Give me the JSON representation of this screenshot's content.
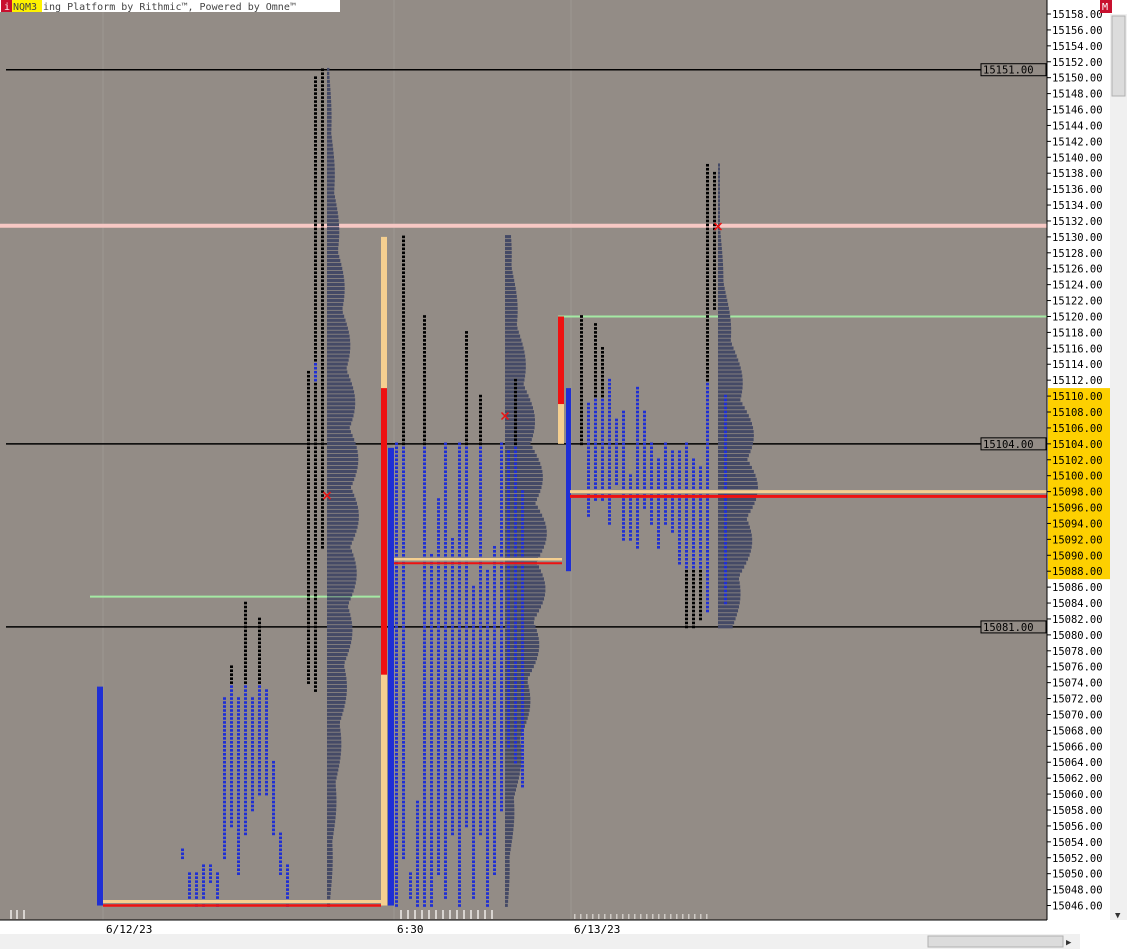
{
  "window": {
    "title_symbol": "NQM3",
    "title_text": "ing Platform by Rithmic™, Powered by Omne™",
    "left_badge": "i",
    "right_badge": "M"
  },
  "colors": {
    "background": "#938c86",
    "axis_bg": "#ffffff",
    "black": "#000000",
    "blue": "#1f2fd4",
    "red": "#ee1111",
    "tan": "#f5cf90",
    "profile": "#454a66",
    "pink": "#f7c8c4",
    "green": "#a4eaa4",
    "highlight": "#fdd000"
  },
  "chart_data": {
    "type": "market-profile",
    "instrument": "NQM3",
    "ylim": [
      15045,
      15159
    ],
    "y_ticks": [
      15158,
      15156,
      15154,
      15152,
      15150,
      15148,
      15146,
      15144,
      15142,
      15140,
      15138,
      15136,
      15134,
      15132,
      15130,
      15128,
      15126,
      15124,
      15122,
      15120,
      15118,
      15116,
      15114,
      15112,
      15110,
      15108,
      15106,
      15104,
      15102,
      15100,
      15098,
      15096,
      15094,
      15092,
      15090,
      15088,
      15086,
      15084,
      15082,
      15080,
      15078,
      15076,
      15074,
      15072,
      15070,
      15068,
      15066,
      15064,
      15062,
      15060,
      15058,
      15056,
      15054,
      15052,
      15050,
      15048,
      15046
    ],
    "y_tick_labels": [
      "15158.00",
      "15156.00",
      "15154.00",
      "15152.00",
      "15150.00",
      "15148.00",
      "15146.00",
      "15144.00",
      "15142.00",
      "15140.00",
      "15138.00",
      "15136.00",
      "15134.00",
      "15132.00",
      "15130.00",
      "15128.00",
      "15126.00",
      "15124.00",
      "15122.00",
      "15120.00",
      "15118.00",
      "15116.00",
      "15114.00",
      "15112.00",
      "15110.00",
      "15108.00",
      "15106.00",
      "15104.00",
      "15102.00",
      "15100.00",
      "15098.00",
      "15096.00",
      "15094.00",
      "15092.00",
      "15090.00",
      "15088.00",
      "15086.00",
      "15084.00",
      "15082.00",
      "15080.00",
      "15078.00",
      "15076.00",
      "15074.00",
      "15072.00",
      "15070.00",
      "15068.00",
      "15066.00",
      "15064.00",
      "15062.00",
      "15060.00",
      "15058.00",
      "15056.00",
      "15054.00",
      "15052.00",
      "15050.00",
      "15048.00",
      "15046.00"
    ],
    "highlight_range": [
      15088,
      15110
    ],
    "x_labels": [
      "6/12/23",
      "6:30",
      "6/13/23"
    ],
    "horizontal_levels": [
      {
        "price": 15151,
        "label": "15151.00",
        "color": "black"
      },
      {
        "price": 15104,
        "label": "15104.00",
        "color": "black"
      },
      {
        "price": 15081,
        "label": "15081.00",
        "color": "black"
      },
      {
        "price": 15131.4,
        "label": "",
        "color": "pink"
      },
      {
        "price": 15120,
        "label": "",
        "color": "green"
      },
      {
        "price": 15084.8,
        "label": "",
        "color": "green"
      }
    ],
    "poc_levels": [
      {
        "price": 15098,
        "color": "tan"
      },
      {
        "price": 15097.4,
        "color": "red"
      },
      {
        "price": 15089.5,
        "color": "tan"
      },
      {
        "price": 15089,
        "color": "red"
      },
      {
        "price": 15046.5,
        "color": "tan"
      },
      {
        "price": 15046,
        "color": "red"
      }
    ],
    "session_ranges": [
      {
        "low": 15046,
        "high": 15130,
        "color": "tan"
      },
      {
        "low": 15075,
        "high": 15111,
        "color": "red"
      },
      {
        "low": 15046,
        "high": 15103.5,
        "color": "blue"
      },
      {
        "low": 15104,
        "high": 15120,
        "color": "tan"
      },
      {
        "low": 15109,
        "high": 15120,
        "color": "red"
      },
      {
        "low": 15088,
        "high": 15111,
        "color": "blue"
      },
      {
        "low": 15046,
        "high": 15073.5,
        "color": "blue"
      }
    ],
    "tpo_columns": [
      {
        "low": 15052,
        "high": 15053,
        "color": "blue"
      },
      {
        "low": 15047,
        "high": 15050,
        "color": "blue"
      },
      {
        "low": 15046,
        "high": 15050,
        "color": "blue"
      },
      {
        "low": 15046,
        "high": 15051,
        "color": "blue"
      },
      {
        "low": 15049,
        "high": 15051,
        "color": "blue"
      },
      {
        "low": 15046,
        "high": 15050,
        "color": "blue"
      },
      {
        "low": 15052,
        "high": 15072,
        "color": "blue"
      },
      {
        "low": 15056,
        "high": 15076,
        "color": "blue",
        "top_black": [
          15074,
          15076
        ]
      },
      {
        "low": 15050,
        "high": 15072,
        "color": "blue"
      },
      {
        "low": 15055,
        "high": 15084,
        "color": "blue",
        "top_black": [
          15074,
          15084
        ]
      },
      {
        "low": 15058,
        "high": 15072,
        "color": "blue"
      },
      {
        "low": 15060,
        "high": 15082,
        "color": "blue",
        "top_black": [
          15074,
          15082
        ]
      },
      {
        "low": 15060,
        "high": 15073,
        "color": "blue"
      },
      {
        "low": 15055,
        "high": 15064,
        "color": "blue"
      },
      {
        "low": 15050,
        "high": 15055,
        "color": "blue"
      },
      {
        "low": 15046,
        "high": 15051,
        "color": "blue"
      },
      {
        "low": 15074,
        "high": 15113,
        "color": "black"
      },
      {
        "low": 15073,
        "high": 15150,
        "color": "black",
        "mid_blue": [
          15112,
          15114
        ]
      },
      {
        "low": 15091,
        "high": 15151,
        "color": "black"
      },
      {
        "low": 15046,
        "high": 15104,
        "color": "blue"
      },
      {
        "low": 15052,
        "high": 15130,
        "color": "blue",
        "top_black": [
          15104,
          15130
        ]
      },
      {
        "low": 15047,
        "high": 15050,
        "color": "blue"
      },
      {
        "low": 15046,
        "high": 15059,
        "color": "blue"
      },
      {
        "low": 15046,
        "high": 15120,
        "color": "blue",
        "top_black": [
          15104,
          15120
        ]
      },
      {
        "low": 15046,
        "high": 15090,
        "color": "blue"
      },
      {
        "low": 15050,
        "high": 15097,
        "color": "blue"
      },
      {
        "low": 15047,
        "high": 15104,
        "color": "blue"
      },
      {
        "low": 15055,
        "high": 15092,
        "color": "blue"
      },
      {
        "low": 15046,
        "high": 15104,
        "color": "blue"
      },
      {
        "low": 15056,
        "high": 15118,
        "color": "blue",
        "top_black": [
          15104,
          15118
        ]
      },
      {
        "low": 15047,
        "high": 15086,
        "color": "blue"
      },
      {
        "low": 15055,
        "high": 15110,
        "color": "blue",
        "top_black": [
          15104,
          15110
        ]
      },
      {
        "low": 15046,
        "high": 15088,
        "color": "blue"
      },
      {
        "low": 15050,
        "high": 15091,
        "color": "blue"
      },
      {
        "low": 15058,
        "high": 15104,
        "color": "blue"
      },
      {
        "low": 15066,
        "high": 15103,
        "color": "blue"
      },
      {
        "low": 15064,
        "high": 15112,
        "color": "blue",
        "top_black": [
          15104,
          15112
        ]
      },
      {
        "low": 15061,
        "high": 15098,
        "color": "blue"
      },
      {
        "low": 15104,
        "high": 15120,
        "color": "black"
      },
      {
        "low": 15095,
        "high": 15109,
        "color": "blue"
      },
      {
        "low": 15097,
        "high": 15119,
        "color": "blue",
        "top_black": [
          15110,
          15119
        ]
      },
      {
        "low": 15097,
        "high": 15116,
        "color": "blue",
        "top_black": [
          15110,
          15116
        ]
      },
      {
        "low": 15094,
        "high": 15112,
        "color": "blue"
      },
      {
        "low": 15099,
        "high": 15107,
        "color": "blue"
      },
      {
        "low": 15092,
        "high": 15108,
        "color": "blue"
      },
      {
        "low": 15092,
        "high": 15100,
        "color": "blue"
      },
      {
        "low": 15091,
        "high": 15111,
        "color": "blue"
      },
      {
        "low": 15096,
        "high": 15108,
        "color": "blue"
      },
      {
        "low": 15094,
        "high": 15104,
        "color": "blue"
      },
      {
        "low": 15091,
        "high": 15102,
        "color": "blue"
      },
      {
        "low": 15094,
        "high": 15104,
        "color": "blue"
      },
      {
        "low": 15093,
        "high": 15103,
        "color": "blue"
      },
      {
        "low": 15089,
        "high": 15103,
        "color": "blue"
      },
      {
        "low": 15081,
        "high": 15104,
        "color": "blue",
        "bottom_black": [
          15081,
          15088
        ]
      },
      {
        "low": 15081,
        "high": 15102,
        "color": "blue",
        "bottom_black": [
          15081,
          15088
        ]
      },
      {
        "low": 15082,
        "high": 15101,
        "color": "blue",
        "bottom_black": [
          15082,
          15088
        ]
      },
      {
        "low": 15083,
        "high": 15139,
        "color": "blue",
        "top_black": [
          15112,
          15139
        ]
      },
      {
        "low": 15121,
        "high": 15138,
        "color": "black"
      },
      {
        "low": 15084,
        "high": 15110,
        "color": "blue"
      }
    ],
    "volume_profiles": [
      {
        "top": 15151,
        "bottom": 15046,
        "peak_price": 15097,
        "peak_width": 32
      },
      {
        "top": 15130,
        "bottom": 15046,
        "peak_price": 15091,
        "peak_width": 42
      },
      {
        "top": 15139,
        "bottom": 15081,
        "peak_price": 15099,
        "peak_width": 40
      }
    ],
    "markers": [
      {
        "price": 15097.5,
        "shape": "x",
        "color": "red"
      },
      {
        "price": 15107.5,
        "shape": "x",
        "color": "red"
      },
      {
        "price": 15131.3,
        "shape": "x",
        "color": "red"
      }
    ]
  }
}
